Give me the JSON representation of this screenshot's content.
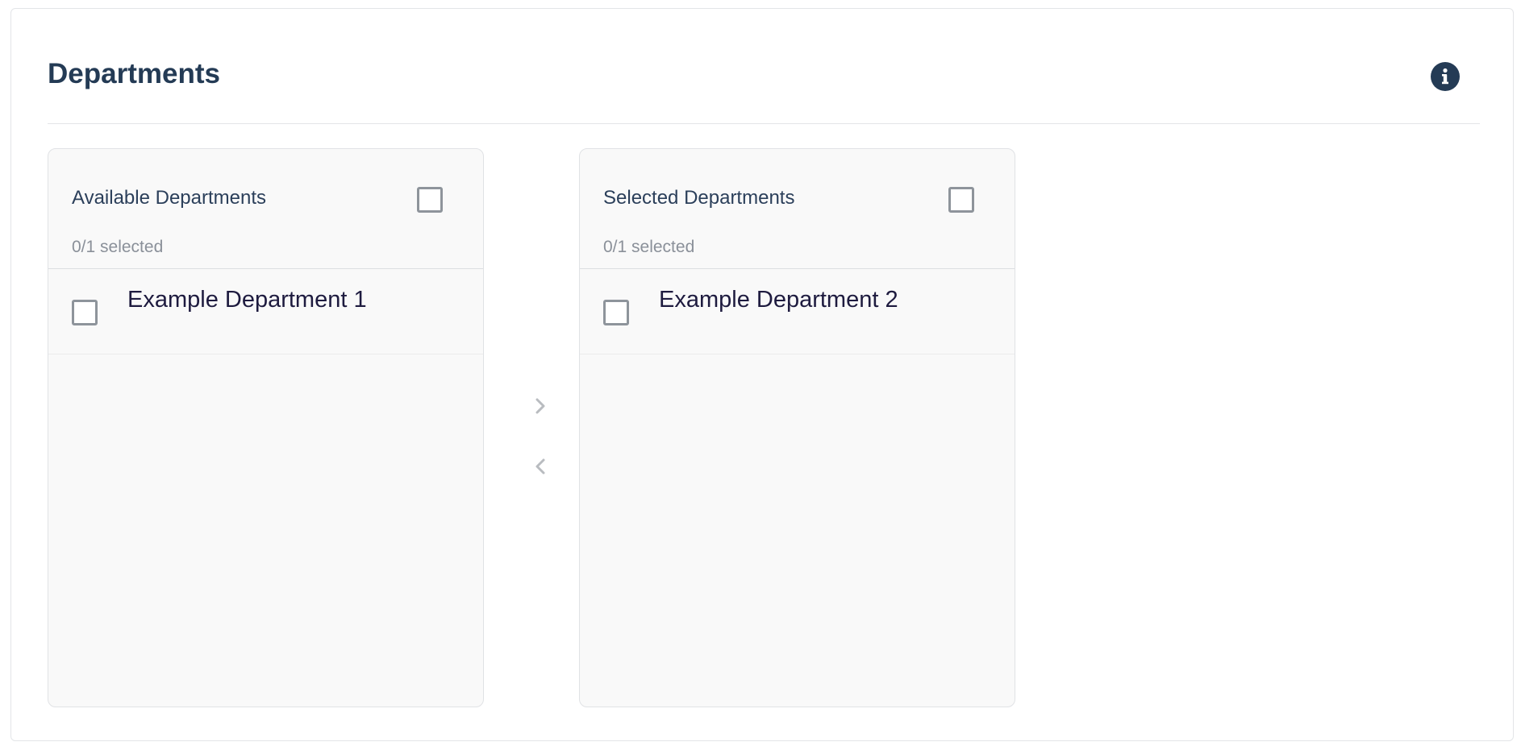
{
  "section": {
    "title": "Departments",
    "info_icon": "info-circle-icon"
  },
  "available": {
    "title": "Available Departments",
    "count": "0/1 selected",
    "items": [
      {
        "label": "Example Department 1",
        "checked": false
      }
    ]
  },
  "selected": {
    "title": "Selected Departments",
    "count": "0/1 selected",
    "items": [
      {
        "label": "Example Department 2",
        "checked": false
      }
    ]
  },
  "controls": {
    "move_right_icon": "chevron-right-icon",
    "move_left_icon": "chevron-left-icon"
  },
  "colors": {
    "primary": "#243b55",
    "muted": "#8a9099",
    "panel_bg": "#f9f9f9",
    "arrow": "#b9bcc0"
  }
}
